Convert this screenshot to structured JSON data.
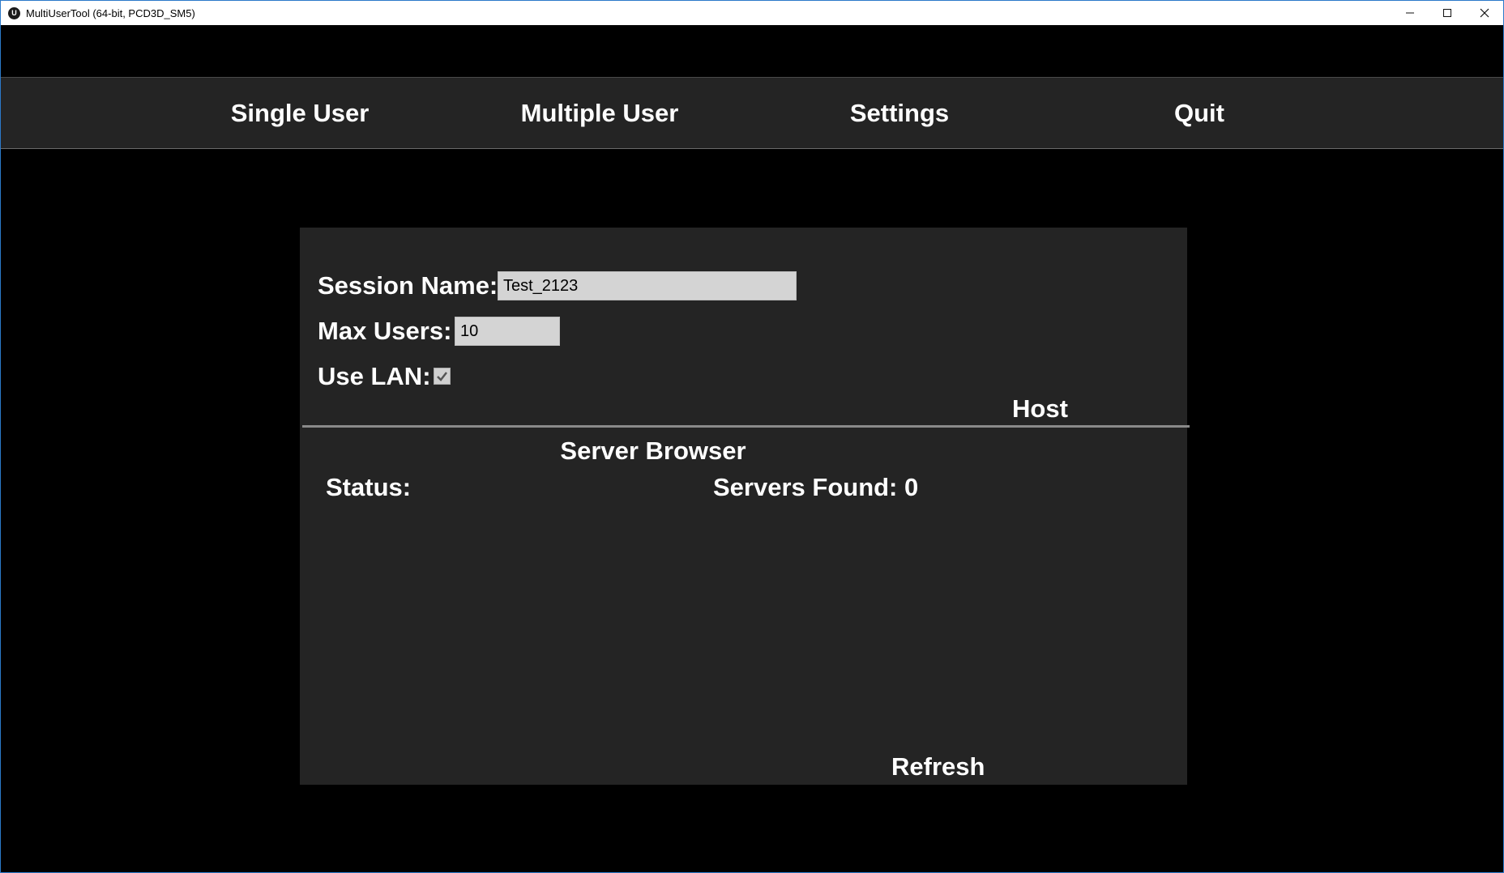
{
  "window": {
    "title": "MultiUserTool (64-bit, PCD3D_SM5)",
    "app_icon_glyph": "U",
    "accent_border": "#2b79c9"
  },
  "menu": {
    "items": [
      {
        "label": "Single User"
      },
      {
        "label": "Multiple User"
      },
      {
        "label": "Settings"
      },
      {
        "label": "Quit"
      }
    ]
  },
  "host_panel": {
    "session_name_label": "Session Name:",
    "session_name_value": "Test_2123",
    "max_users_label": "Max Users:",
    "max_users_value": "10",
    "use_lan_label": "Use LAN:",
    "use_lan_checked": true,
    "host_button": "Host"
  },
  "server_browser": {
    "title": "Server Browser",
    "status_label": "Status:",
    "servers_found_label": "Servers Found: 0",
    "refresh_button": "Refresh"
  },
  "colors": {
    "background": "#000000",
    "panel": "#242424",
    "input": "#d4d4d4",
    "text": "#ffffff"
  }
}
